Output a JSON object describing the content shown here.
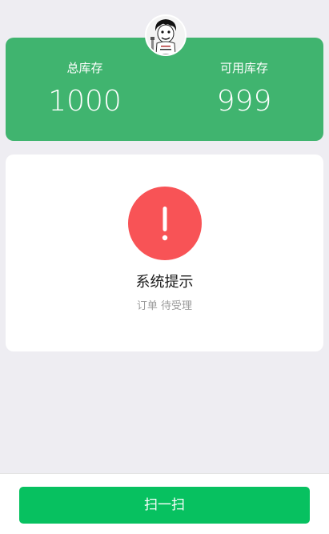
{
  "colors": {
    "background": "#eeedf2",
    "stock_card": "#40b46f",
    "warning": "#f85356",
    "primary_button": "#07c160"
  },
  "stock": {
    "total_label": "总库存",
    "total_value": "1000",
    "available_label": "可用库存",
    "available_value": "999"
  },
  "message": {
    "icon": "warning-exclamation-icon",
    "title": "系统提示",
    "desc": "订单 待受理"
  },
  "footer": {
    "scan_label": "扫一扫"
  }
}
